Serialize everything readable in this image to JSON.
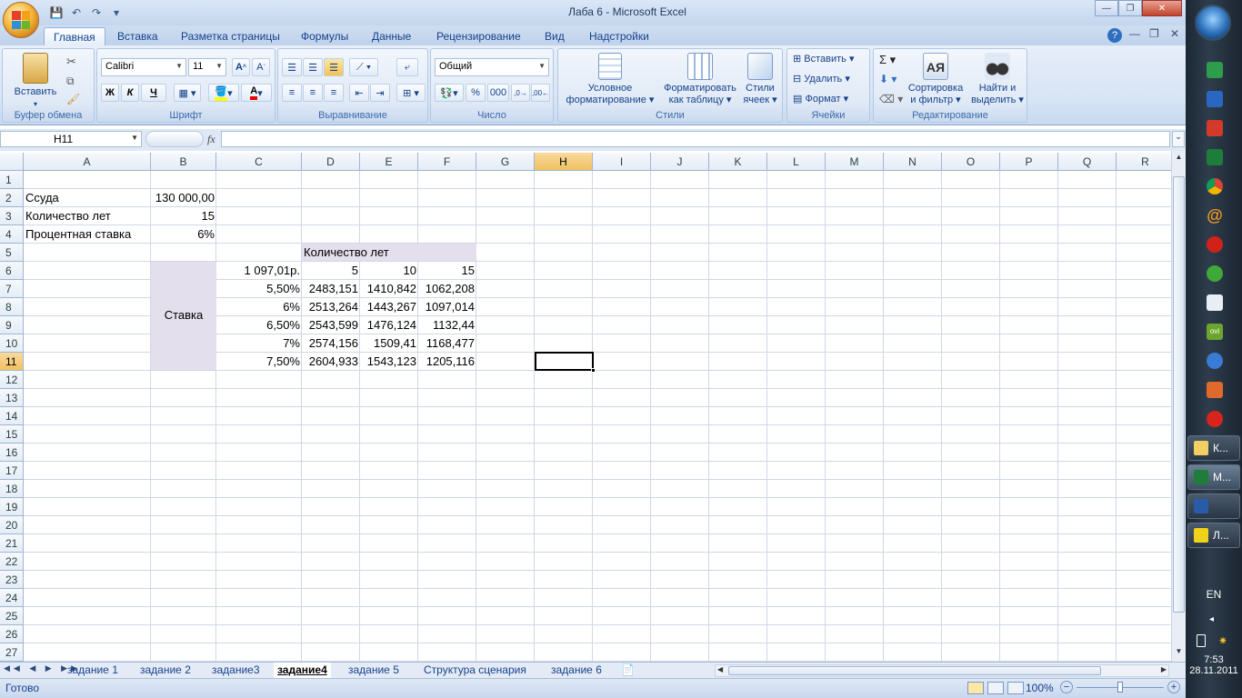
{
  "window": {
    "title": "Лаба 6 - Microsoft Excel"
  },
  "ribbon_tabs": [
    "Главная",
    "Вставка",
    "Разметка страницы",
    "Формулы",
    "Данные",
    "Рецензирование",
    "Вид",
    "Надстройки"
  ],
  "groups": {
    "clipboard": {
      "label": "Буфер обмена",
      "paste": "Вставить"
    },
    "font": {
      "label": "Шрифт",
      "font_name": "Calibri",
      "font_size": "11",
      "bold": "Ж",
      "italic": "К",
      "underline": "Ч"
    },
    "alignment": {
      "label": "Выравнивание"
    },
    "number": {
      "label": "Число",
      "format": "Общий",
      "percent": "%",
      "thousands": "000"
    },
    "styles": {
      "label": "Стили",
      "cond": "Условное форматирование",
      "table": "Форматировать как таблицу",
      "cell_styles": "Стили ячеек"
    },
    "cells": {
      "label": "Ячейки",
      "insert": "Вставить",
      "delete": "Удалить",
      "format": "Формат"
    },
    "editing": {
      "label": "Редактирование",
      "sort": "Сортировка и фильтр",
      "find": "Найти и выделить"
    }
  },
  "formula_bar": {
    "name_box": "H11",
    "fx": "fx",
    "formula": ""
  },
  "columns": [
    "A",
    "B",
    "C",
    "D",
    "E",
    "F",
    "G",
    "H",
    "I",
    "J",
    "K",
    "L",
    "M",
    "N",
    "O",
    "P",
    "Q",
    "R"
  ],
  "rows": [
    "1",
    "2",
    "3",
    "4",
    "5",
    "6",
    "7",
    "8",
    "9",
    "10",
    "11",
    "12",
    "13",
    "14",
    "15",
    "16",
    "17",
    "18",
    "19",
    "20",
    "21",
    "22",
    "23",
    "24",
    "25",
    "26",
    "27"
  ],
  "cells": {
    "A2": "Ссуда",
    "B2": "130 000,00",
    "A3": "Количество лет",
    "B3": "15",
    "A4": "Процентная ставка",
    "B4": "6%",
    "D5": "Количество лет",
    "C6": "1 097,01р.",
    "D6": "5",
    "E6": "10",
    "F6": "15",
    "B8": "Ставка",
    "C7": "5,50%",
    "D7": "2483,151",
    "E7": "1410,842",
    "F7": "1062,208",
    "C8": "6%",
    "D8": "2513,264",
    "E8": "1443,267",
    "F8": "1097,014",
    "C9": "6,50%",
    "D9": "2543,599",
    "E9": "1476,124",
    "F9": "1132,44",
    "C10": "7%",
    "D10": "2574,156",
    "E10": "1509,41",
    "F10": "1168,477",
    "C11": "7,50%",
    "D11": "2604,933",
    "E11": "1543,123",
    "F11": "1205,116"
  },
  "sheet_tabs": [
    "задание 1",
    "задание 2",
    "задание3",
    "задание4",
    "задание 5",
    "Структура сценария",
    "задание 6"
  ],
  "active_sheet": "задание4",
  "status": {
    "ready": "Готово",
    "zoom": "100%"
  },
  "taskbar": {
    "lang": "EN",
    "time": "7:53",
    "date": "28.11.2011",
    "btn1": "К...",
    "btn2": "М...",
    "btn4": "Л..."
  }
}
